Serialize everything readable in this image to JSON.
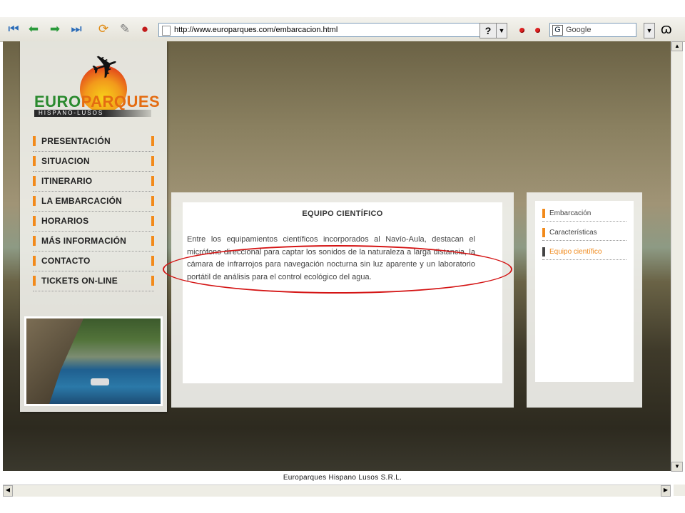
{
  "browser": {
    "url": "http://www.europarques.com/embarcacion.html",
    "search_engine": "Google",
    "help_label": "?",
    "status_text": "Europarques Hispano Lusos S.R.L."
  },
  "logo": {
    "name_part1": "EURO",
    "name_part2": "PARQUES",
    "subtitle": "HISPANO-LUSOS"
  },
  "nav": {
    "items": [
      {
        "label": "PRESENTACIÓN"
      },
      {
        "label": "SITUACION"
      },
      {
        "label": "ITINERARIO"
      },
      {
        "label": "LA EMBARCACIÓN"
      },
      {
        "label": "HORARIOS"
      },
      {
        "label": "MÁS INFORMACIÓN"
      },
      {
        "label": "CONTACTO"
      },
      {
        "label": "TICKETS ON-LINE"
      }
    ]
  },
  "main": {
    "title": "EQUIPO CIENTÍFICO",
    "body": "Entre los equipamientos científicos incorporados al Navío-Aula, destacan el micrófono direccional para captar los sonidos de la naturaleza a larga distancia, la cámara de infrarrojos para navegación nocturna sin luz aparente y un laboratorio portátil de análisis para el control ecológico del agua."
  },
  "sidebar": {
    "items": [
      {
        "label": "Embarcación"
      },
      {
        "label": "Características"
      },
      {
        "label": "Equipo científico"
      }
    ]
  },
  "colors": {
    "accent_orange": "#f28a1a",
    "annotation_red": "#d41414",
    "logo_green": "#2b8a2f"
  }
}
